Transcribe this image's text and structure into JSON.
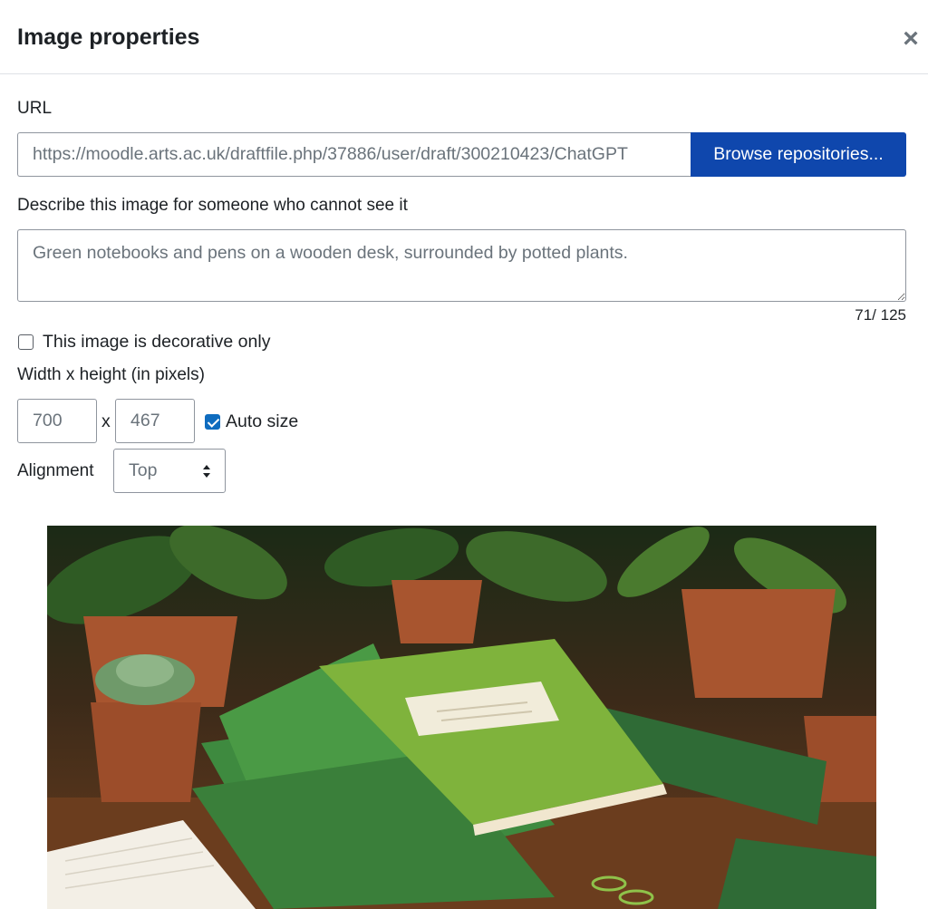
{
  "dialog": {
    "title": "Image properties",
    "close_symbol": "×",
    "url_label": "URL",
    "url_value": "https://moodle.arts.ac.uk/draftfile.php/37886/user/draft/300210423/ChatGPT",
    "browse_label": "Browse repositories...",
    "alt_label": "Describe this image for someone who cannot see it",
    "alt_value": "Green notebooks and pens on a wooden desk, surrounded by potted plants.",
    "alt_counter": "71/ 125",
    "decorative_label": "This image is decorative only",
    "decorative_checked": false,
    "size_label": "Width x height (in pixels)",
    "width_value": "700",
    "times_symbol": "x",
    "height_value": "467",
    "autosize_label": "Auto size",
    "autosize_checked": true,
    "alignment_label": "Alignment",
    "alignment_value": "Top",
    "alignment_options": [
      "Top"
    ]
  },
  "preview": {
    "icon": "image-preview",
    "desk_color": "#6b3d1e",
    "notebook_color": "#7fb33c",
    "dark_notebook_color": "#2f6b36",
    "pot_color": "#a8552f",
    "leaf_color": "#2f5b24"
  },
  "colors": {
    "primary": "#0f47ad",
    "checkbox": "#0f6cbf",
    "border": "#8f959e",
    "placeholder_text": "#6a737b"
  }
}
